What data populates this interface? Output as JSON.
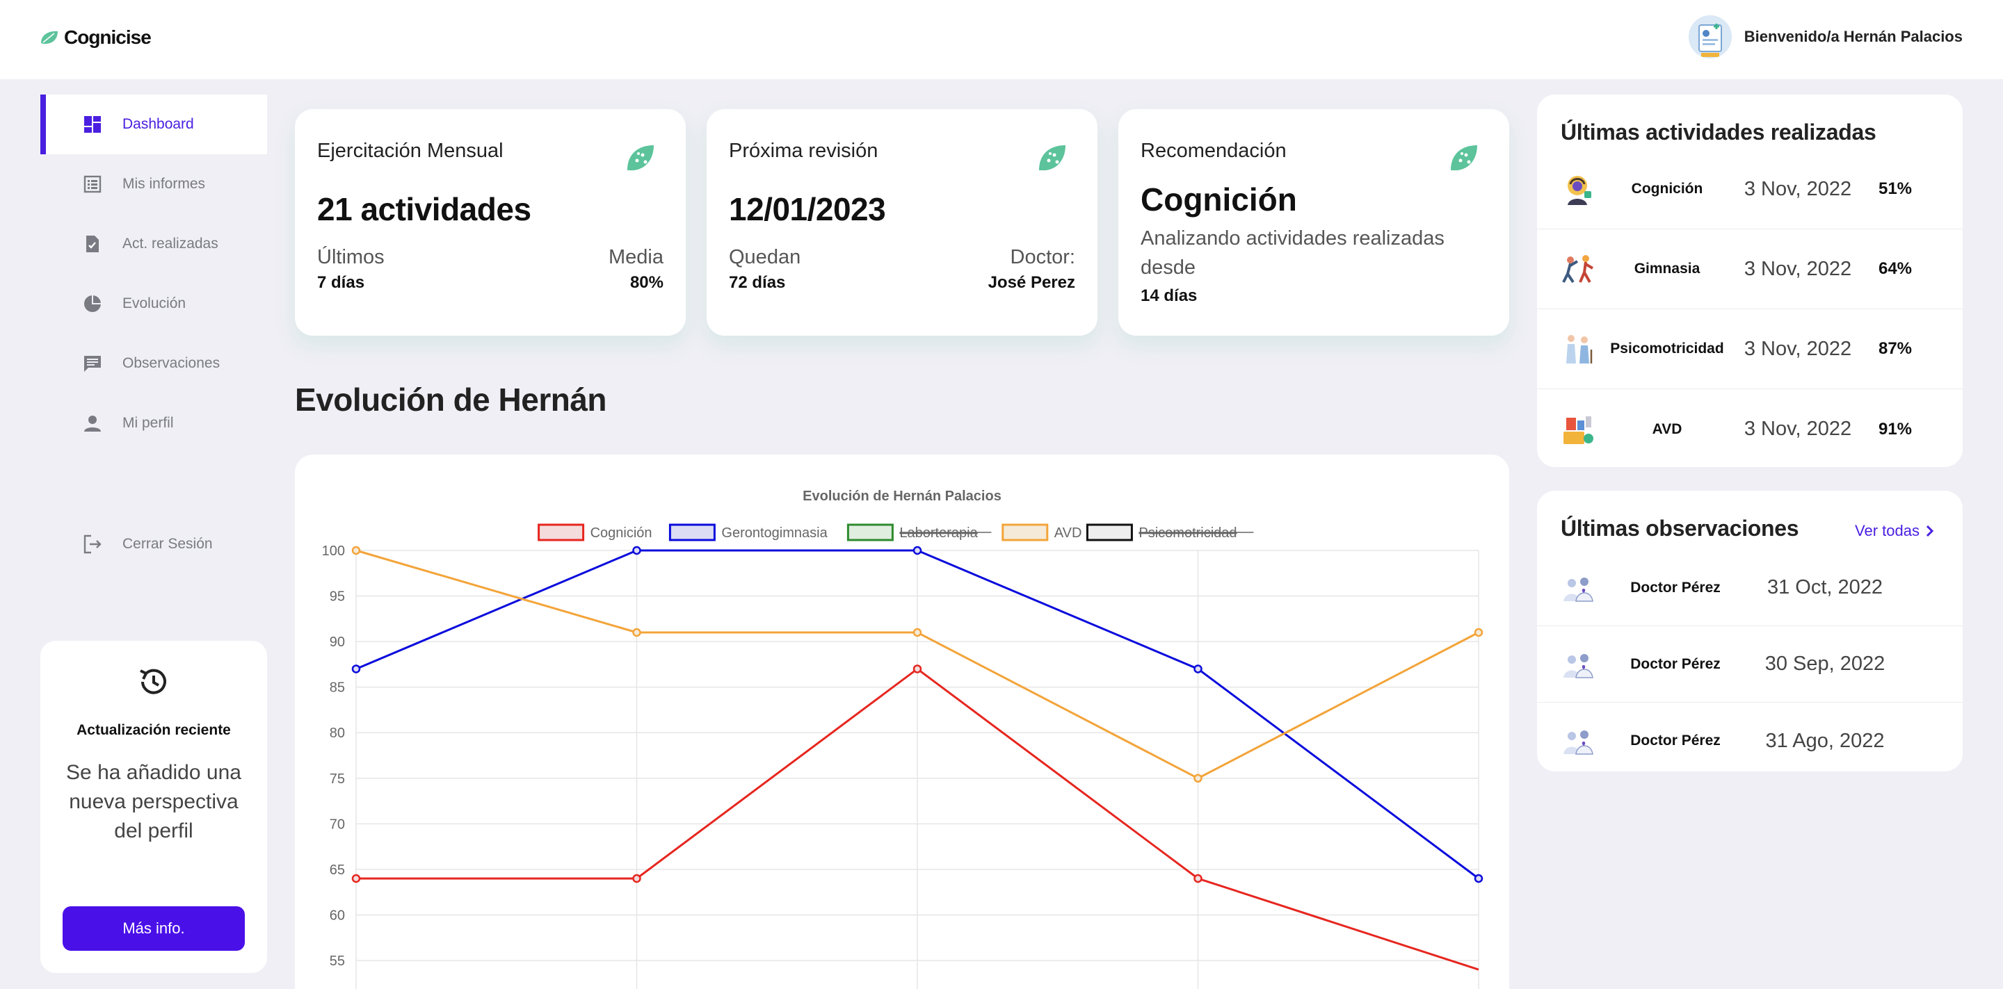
{
  "app": {
    "name": "Cognicise"
  },
  "header": {
    "welcome": "Bienvenido/a Hernán Palacios"
  },
  "sidebar": {
    "items": [
      {
        "label": "Dashboard",
        "icon": "dashboard-icon",
        "active": true
      },
      {
        "label": "Mis informes",
        "icon": "report-icon"
      },
      {
        "label": "Act. realizadas",
        "icon": "document-check-icon"
      },
      {
        "label": "Evolución",
        "icon": "pie-chart-icon"
      },
      {
        "label": "Observaciones",
        "icon": "comment-icon"
      },
      {
        "label": "Mi perfil",
        "icon": "person-icon"
      }
    ],
    "logout": "Cerrar Sesión"
  },
  "recent_update": {
    "title": "Actualización reciente",
    "text": "Se ha añadido una nueva perspectiva del perfil",
    "button": "Más info."
  },
  "cards": [
    {
      "title": "Ejercitación Mensual",
      "big": "21 actividades",
      "left_label": "Últimos",
      "left_value": "7 días",
      "right_label": "Media",
      "right_value": "80%"
    },
    {
      "title": "Próxima revisión",
      "big": "12/01/2023",
      "left_label": "Quedan",
      "left_value": "72 días",
      "right_label": "Doctor:",
      "right_value": "José Perez"
    },
    {
      "title": "Recomendación",
      "big": "Cognición",
      "desc": "Analizando actividades realizadas desde",
      "value": "14 días"
    }
  ],
  "section_title": "Evolución de Hernán",
  "chart_data": {
    "type": "line",
    "title": "Evolución de Hernán Palacios",
    "xlabel": "",
    "ylabel": "",
    "ylim": [
      55,
      100
    ],
    "yticks": [
      100,
      95,
      90,
      85,
      80,
      75,
      70,
      65,
      60,
      55
    ],
    "grid": true,
    "legend_position": "top",
    "series": [
      {
        "name": "Cognición",
        "color": "#e6261f",
        "fill": "#f4dcdc",
        "hidden": false,
        "values": [
          64,
          64,
          87,
          64,
          54
        ]
      },
      {
        "name": "Gerontogimnasia",
        "color": "#0b0bdc",
        "fill": "#dcdcf4",
        "hidden": false,
        "values": [
          87,
          100,
          100,
          87,
          64
        ]
      },
      {
        "name": "Laborterapia",
        "color": "#2e8b2e",
        "fill": "#e0eee0",
        "hidden": true,
        "values": []
      },
      {
        "name": "AVD",
        "color": "#f3a43a",
        "fill": "#f5ead8",
        "hidden": false,
        "values": [
          100,
          91,
          91,
          75,
          91
        ]
      },
      {
        "name": "Psicomotricidad",
        "color": "#111111",
        "fill": "#eeeeee",
        "hidden": true,
        "values": []
      }
    ]
  },
  "activities": {
    "title": "Últimas actividades realizadas",
    "rows": [
      {
        "name": "Cognición",
        "date": "3 Nov, 2022",
        "pct": "51%",
        "icon": "brain-person-icon"
      },
      {
        "name": "Gimnasia",
        "date": "3 Nov, 2022",
        "pct": "64%",
        "icon": "exercise-people-icon"
      },
      {
        "name": "Psicomotricidad",
        "date": "3 Nov, 2022",
        "pct": "87%",
        "icon": "elderly-couple-icon"
      },
      {
        "name": "AVD",
        "date": "3 Nov, 2022",
        "pct": "91%",
        "icon": "daily-tasks-icon"
      }
    ]
  },
  "observations": {
    "title": "Últimas observaciones",
    "see_all": "Ver todas",
    "rows": [
      {
        "name": "Doctor Pérez",
        "date": "31 Oct, 2022"
      },
      {
        "name": "Doctor Pérez",
        "date": "30 Sep, 2022"
      },
      {
        "name": "Doctor Pérez",
        "date": "31 Ago, 2022"
      }
    ]
  }
}
